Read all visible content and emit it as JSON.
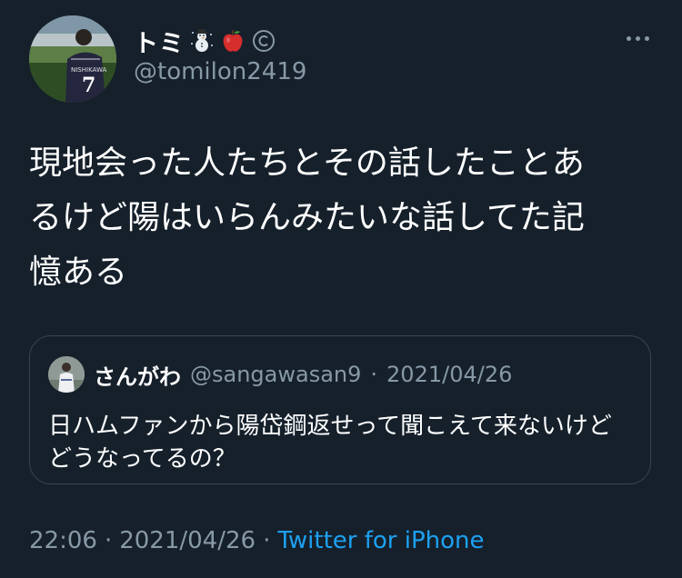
{
  "author": {
    "display_name": "トミ",
    "badges": [
      "snowman-icon",
      "apple-icon",
      "copyright-icon"
    ],
    "handle": "@tomilon2419",
    "avatar_jersey_name": "NISHIKAWA",
    "avatar_jersey_number": "7"
  },
  "tweet": {
    "text": "現地会った人たちとその話したことあ\nるけど陽はいらんみたいな話してた記\n憶ある"
  },
  "quote": {
    "display_name": "さんがわ",
    "handle": "@sangawasan9",
    "separator": "·",
    "date": "2021/04/26",
    "text": "日ハムファンから陽岱鋼返せって聞こえて来ないけど\nどうなってるの？"
  },
  "meta": {
    "time": "22:06",
    "separator1": "·",
    "date": "2021/04/26",
    "separator2": "·",
    "source": "Twitter for iPhone"
  },
  "colors": {
    "background": "#15202b",
    "secondary_text": "#8899a6",
    "link": "#1da1f2",
    "border": "#38444d"
  }
}
